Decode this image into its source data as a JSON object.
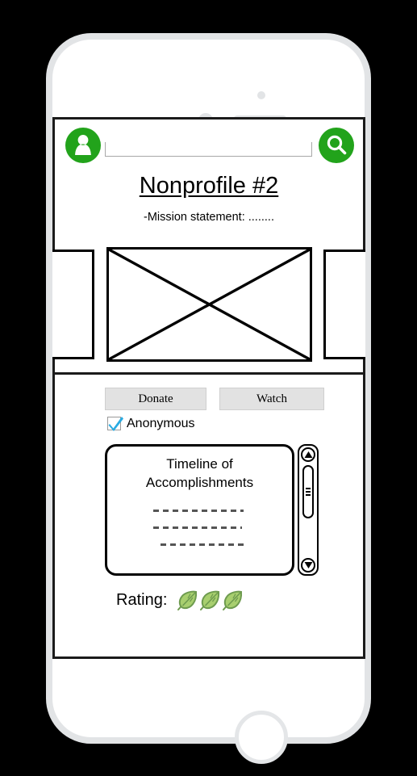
{
  "device": {
    "type": "smartphone-mockup",
    "frame_color": "#e2e4e6",
    "screen_bg": "#ffffff",
    "hardware": {
      "silent_switch": "silent-switch",
      "volume_up": "volume-up-button",
      "volume_down": "volume-down-button",
      "power": "power-button",
      "home": "home-button",
      "camera": "front-camera",
      "sensor": "proximity-sensor",
      "speaker": "earpiece-speaker"
    }
  },
  "header": {
    "avatar_icon": "person-icon",
    "search_icon": "search-icon",
    "accent_color": "#22a31b",
    "search": {
      "value": "",
      "placeholder": ""
    }
  },
  "page": {
    "title": "Nonprofile #2",
    "mission": "-Mission statement: ........"
  },
  "media": {
    "placeholder_icon": "image-placeholder-crossed-box",
    "left_panel": "carousel-panel-left",
    "right_panel": "carousel-panel-right"
  },
  "actions": {
    "donate_label": "Donate",
    "watch_label": "Watch",
    "anonymous_label": "Anonymous",
    "anonymous_checked": true,
    "checkmark_color": "#29abe2"
  },
  "timeline": {
    "title_line1": "Timeline of",
    "title_line2": "Accomplishments",
    "entries": [
      "----------------",
      "---------------",
      "---------------"
    ],
    "scrollbar": {
      "up_arrow": "scroll-up-arrow-icon",
      "down_arrow": "scroll-down-arrow-icon",
      "thumb": "scrollbar-thumb"
    }
  },
  "rating": {
    "label": "Rating:",
    "icon": "leaf-icon",
    "count": 3,
    "leaf_fill": "#a8cf6f",
    "leaf_edge": "#6e9b4f"
  }
}
